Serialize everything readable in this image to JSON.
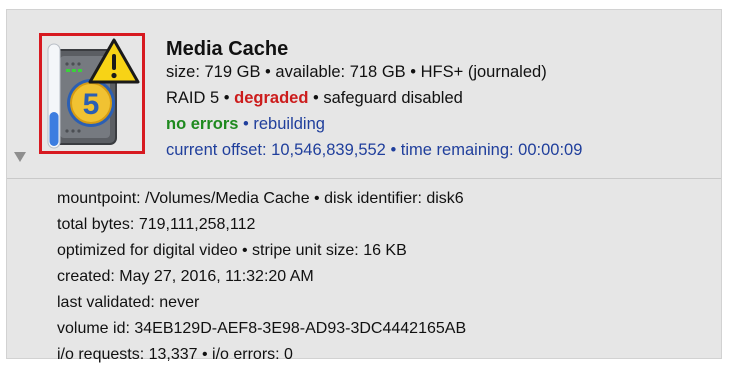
{
  "volume": {
    "name": "Media Cache",
    "size_line": "size: 719 GB • available: 718 GB • HFS+ (journaled)",
    "raid_prefix": "RAID 5 • ",
    "raid_status": "degraded",
    "raid_suffix": " • safeguard disabled",
    "errors_status": "no errors",
    "task_separator": " • ",
    "task_status": "rebuilding",
    "progress_line": "current offset: 10,546,839,552 • time remaining: 00:00:09",
    "raid_level_badge": "5"
  },
  "details": {
    "mountpoint": "mountpoint: /Volumes/Media Cache • disk identifier: disk6",
    "total_bytes": "total bytes: 719,111,258,112",
    "optimization": "optimized for digital video • stripe unit size: 16 KB",
    "created": "created: May 27, 2016, 11:32:20 AM",
    "last_validated": "last validated: never",
    "volume_id": "volume id: 34EB129D-AEF8-3E98-AD93-3DC4442165AB",
    "io": "i/o requests: 13,337 • i/o errors: 0"
  },
  "icons": {
    "volume": "raid-volume-icon",
    "warning": "warning-triangle-icon",
    "disclosure": "disclosure-triangle-icon"
  },
  "colors": {
    "degraded": "#cc1c1c",
    "no_errors": "#1f8a1f",
    "info_blue": "#203f9c",
    "highlight_frame": "#d71920",
    "warning_yellow": "#f7d316"
  }
}
